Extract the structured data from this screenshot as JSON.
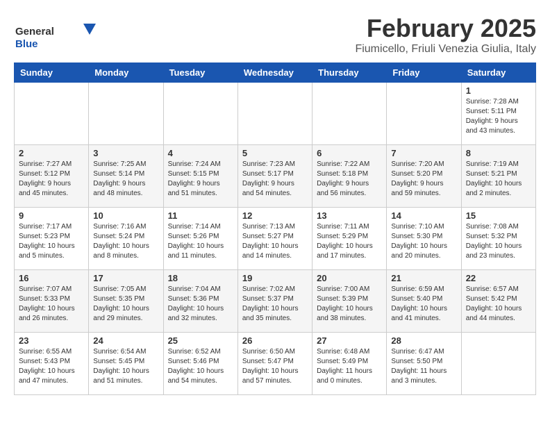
{
  "header": {
    "logo_line1": "General",
    "logo_line2": "Blue",
    "month": "February 2025",
    "location": "Fiumicello, Friuli Venezia Giulia, Italy"
  },
  "days_of_week": [
    "Sunday",
    "Monday",
    "Tuesday",
    "Wednesday",
    "Thursday",
    "Friday",
    "Saturday"
  ],
  "weeks": [
    [
      {
        "day": "",
        "info": ""
      },
      {
        "day": "",
        "info": ""
      },
      {
        "day": "",
        "info": ""
      },
      {
        "day": "",
        "info": ""
      },
      {
        "day": "",
        "info": ""
      },
      {
        "day": "",
        "info": ""
      },
      {
        "day": "1",
        "info": "Sunrise: 7:28 AM\nSunset: 5:11 PM\nDaylight: 9 hours and 43 minutes."
      }
    ],
    [
      {
        "day": "2",
        "info": "Sunrise: 7:27 AM\nSunset: 5:12 PM\nDaylight: 9 hours and 45 minutes."
      },
      {
        "day": "3",
        "info": "Sunrise: 7:25 AM\nSunset: 5:14 PM\nDaylight: 9 hours and 48 minutes."
      },
      {
        "day": "4",
        "info": "Sunrise: 7:24 AM\nSunset: 5:15 PM\nDaylight: 9 hours and 51 minutes."
      },
      {
        "day": "5",
        "info": "Sunrise: 7:23 AM\nSunset: 5:17 PM\nDaylight: 9 hours and 54 minutes."
      },
      {
        "day": "6",
        "info": "Sunrise: 7:22 AM\nSunset: 5:18 PM\nDaylight: 9 hours and 56 minutes."
      },
      {
        "day": "7",
        "info": "Sunrise: 7:20 AM\nSunset: 5:20 PM\nDaylight: 9 hours and 59 minutes."
      },
      {
        "day": "8",
        "info": "Sunrise: 7:19 AM\nSunset: 5:21 PM\nDaylight: 10 hours and 2 minutes."
      }
    ],
    [
      {
        "day": "9",
        "info": "Sunrise: 7:17 AM\nSunset: 5:23 PM\nDaylight: 10 hours and 5 minutes."
      },
      {
        "day": "10",
        "info": "Sunrise: 7:16 AM\nSunset: 5:24 PM\nDaylight: 10 hours and 8 minutes."
      },
      {
        "day": "11",
        "info": "Sunrise: 7:14 AM\nSunset: 5:26 PM\nDaylight: 10 hours and 11 minutes."
      },
      {
        "day": "12",
        "info": "Sunrise: 7:13 AM\nSunset: 5:27 PM\nDaylight: 10 hours and 14 minutes."
      },
      {
        "day": "13",
        "info": "Sunrise: 7:11 AM\nSunset: 5:29 PM\nDaylight: 10 hours and 17 minutes."
      },
      {
        "day": "14",
        "info": "Sunrise: 7:10 AM\nSunset: 5:30 PM\nDaylight: 10 hours and 20 minutes."
      },
      {
        "day": "15",
        "info": "Sunrise: 7:08 AM\nSunset: 5:32 PM\nDaylight: 10 hours and 23 minutes."
      }
    ],
    [
      {
        "day": "16",
        "info": "Sunrise: 7:07 AM\nSunset: 5:33 PM\nDaylight: 10 hours and 26 minutes."
      },
      {
        "day": "17",
        "info": "Sunrise: 7:05 AM\nSunset: 5:35 PM\nDaylight: 10 hours and 29 minutes."
      },
      {
        "day": "18",
        "info": "Sunrise: 7:04 AM\nSunset: 5:36 PM\nDaylight: 10 hours and 32 minutes."
      },
      {
        "day": "19",
        "info": "Sunrise: 7:02 AM\nSunset: 5:37 PM\nDaylight: 10 hours and 35 minutes."
      },
      {
        "day": "20",
        "info": "Sunrise: 7:00 AM\nSunset: 5:39 PM\nDaylight: 10 hours and 38 minutes."
      },
      {
        "day": "21",
        "info": "Sunrise: 6:59 AM\nSunset: 5:40 PM\nDaylight: 10 hours and 41 minutes."
      },
      {
        "day": "22",
        "info": "Sunrise: 6:57 AM\nSunset: 5:42 PM\nDaylight: 10 hours and 44 minutes."
      }
    ],
    [
      {
        "day": "23",
        "info": "Sunrise: 6:55 AM\nSunset: 5:43 PM\nDaylight: 10 hours and 47 minutes."
      },
      {
        "day": "24",
        "info": "Sunrise: 6:54 AM\nSunset: 5:45 PM\nDaylight: 10 hours and 51 minutes."
      },
      {
        "day": "25",
        "info": "Sunrise: 6:52 AM\nSunset: 5:46 PM\nDaylight: 10 hours and 54 minutes."
      },
      {
        "day": "26",
        "info": "Sunrise: 6:50 AM\nSunset: 5:47 PM\nDaylight: 10 hours and 57 minutes."
      },
      {
        "day": "27",
        "info": "Sunrise: 6:48 AM\nSunset: 5:49 PM\nDaylight: 11 hours and 0 minutes."
      },
      {
        "day": "28",
        "info": "Sunrise: 6:47 AM\nSunset: 5:50 PM\nDaylight: 11 hours and 3 minutes."
      },
      {
        "day": "",
        "info": ""
      }
    ]
  ]
}
